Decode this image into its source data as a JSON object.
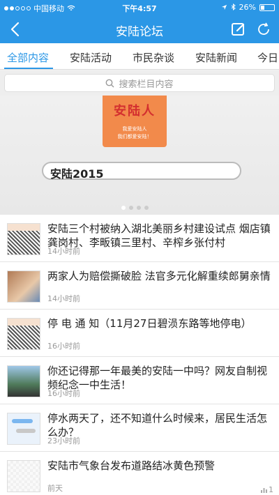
{
  "status": {
    "carrier": "中国移动",
    "time": "下午4:57",
    "battery": "26%",
    "battery_level": 0.26
  },
  "nav": {
    "title": "安陆论坛"
  },
  "tabs": [
    {
      "label": "全部内容",
      "active": true
    },
    {
      "label": "安陆活动",
      "active": false
    },
    {
      "label": "市民杂谈",
      "active": false
    },
    {
      "label": "安陆新闻",
      "active": false
    },
    {
      "label": "今日",
      "active": false
    }
  ],
  "search": {
    "placeholder": "搜索栏目内容"
  },
  "banner": {
    "logo_title": "安陆人",
    "logo_line1": "我爱安陆人",
    "logo_line2": "我们都爱安陆！",
    "search_text": "安陆2015"
  },
  "list": [
    {
      "title": "安陆三个村被纳入湖北美丽乡村建设试点 烟店镇龚岗村、李畈镇三里村、辛榨乡张付村",
      "time": "14小时前",
      "thumb": "qr"
    },
    {
      "title": "两家人为赔偿撕破脸 法官多元化解重续郎舅亲情",
      "time": "14小时前",
      "thumb": "people"
    },
    {
      "title": "停 电 通 知（11月27日碧涢东路等地停电）",
      "time": "16小时前",
      "thumb": "qr"
    },
    {
      "title": "你还记得那一年最美的安陆一中吗？网友自制视频纪念一中生活！",
      "time": "16小时前",
      "thumb": "person"
    },
    {
      "title": "停水两天了，还不知道什么时候来，居民生活怎么办？",
      "time": "23小时前",
      "thumb": "chat"
    },
    {
      "title": "安陆市气象台发布道路结冰黄色预警",
      "time": "前天",
      "thumb": "blank",
      "stat": "1"
    }
  ],
  "colors": {
    "accent": "#2b97e6"
  }
}
